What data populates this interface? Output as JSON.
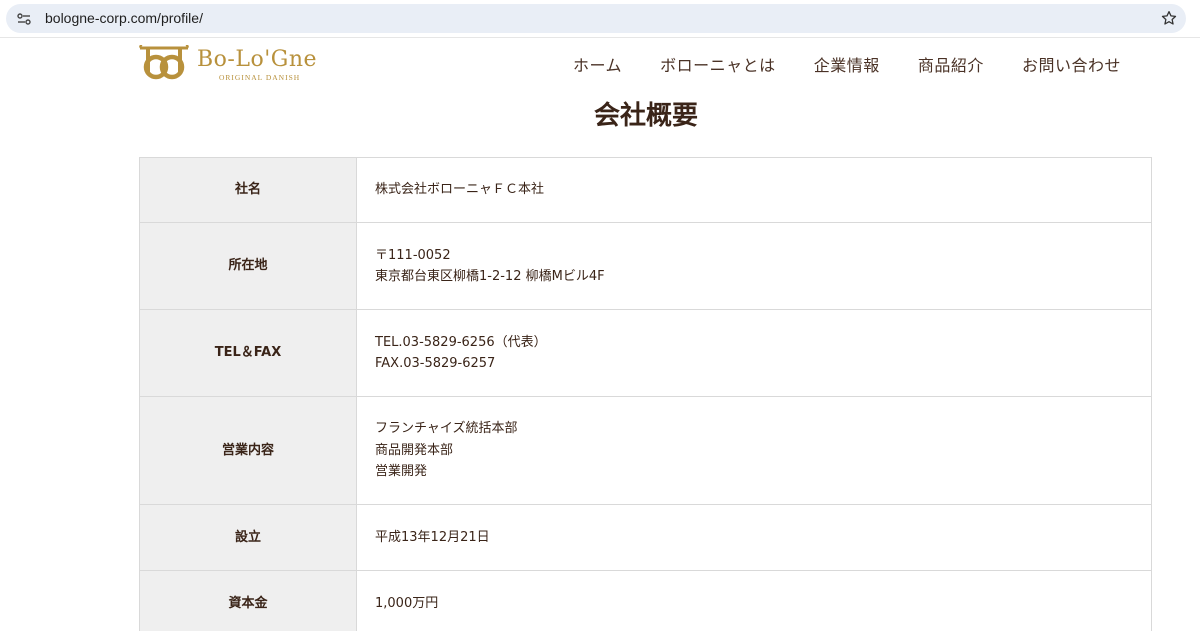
{
  "browser": {
    "url": "bologne-corp.com/profile/"
  },
  "header": {
    "logo_text": "Bo-Lo'Gne",
    "logo_subtext": "ORIGINAL DANISH",
    "nav": [
      {
        "label": "ホーム"
      },
      {
        "label": "ボローニャとは"
      },
      {
        "label": "企業情報"
      },
      {
        "label": "商品紹介"
      },
      {
        "label": "お問い合わせ"
      }
    ]
  },
  "main": {
    "title": "会社概要",
    "rows": [
      {
        "label": "社名",
        "lines": [
          "株式会社ボローニャＦＣ本社"
        ]
      },
      {
        "label": "所在地",
        "lines": [
          "〒111-0052",
          "東京都台東区柳橋1-2-12 柳橋Mビル4F"
        ]
      },
      {
        "label": "TEL＆FAX",
        "lines": [
          "TEL.03-5829-6256（代表）",
          "FAX.03-5829-6257"
        ]
      },
      {
        "label": "営業内容",
        "lines": [
          "フランチャイズ統括本部",
          "商品開発本部",
          "営業開発"
        ]
      },
      {
        "label": "設立",
        "lines": [
          "平成13年12月21日"
        ]
      },
      {
        "label": "資本金",
        "lines": [
          "1,000万円"
        ]
      }
    ]
  },
  "colors": {
    "brand_gold": "#b8913c",
    "text_brown": "#3a2418",
    "label_bg": "#efefef"
  },
  "icons": {
    "site_info": "tune-icon",
    "bookmark": "star-icon",
    "logo_mark": "bo-logo-icon"
  }
}
